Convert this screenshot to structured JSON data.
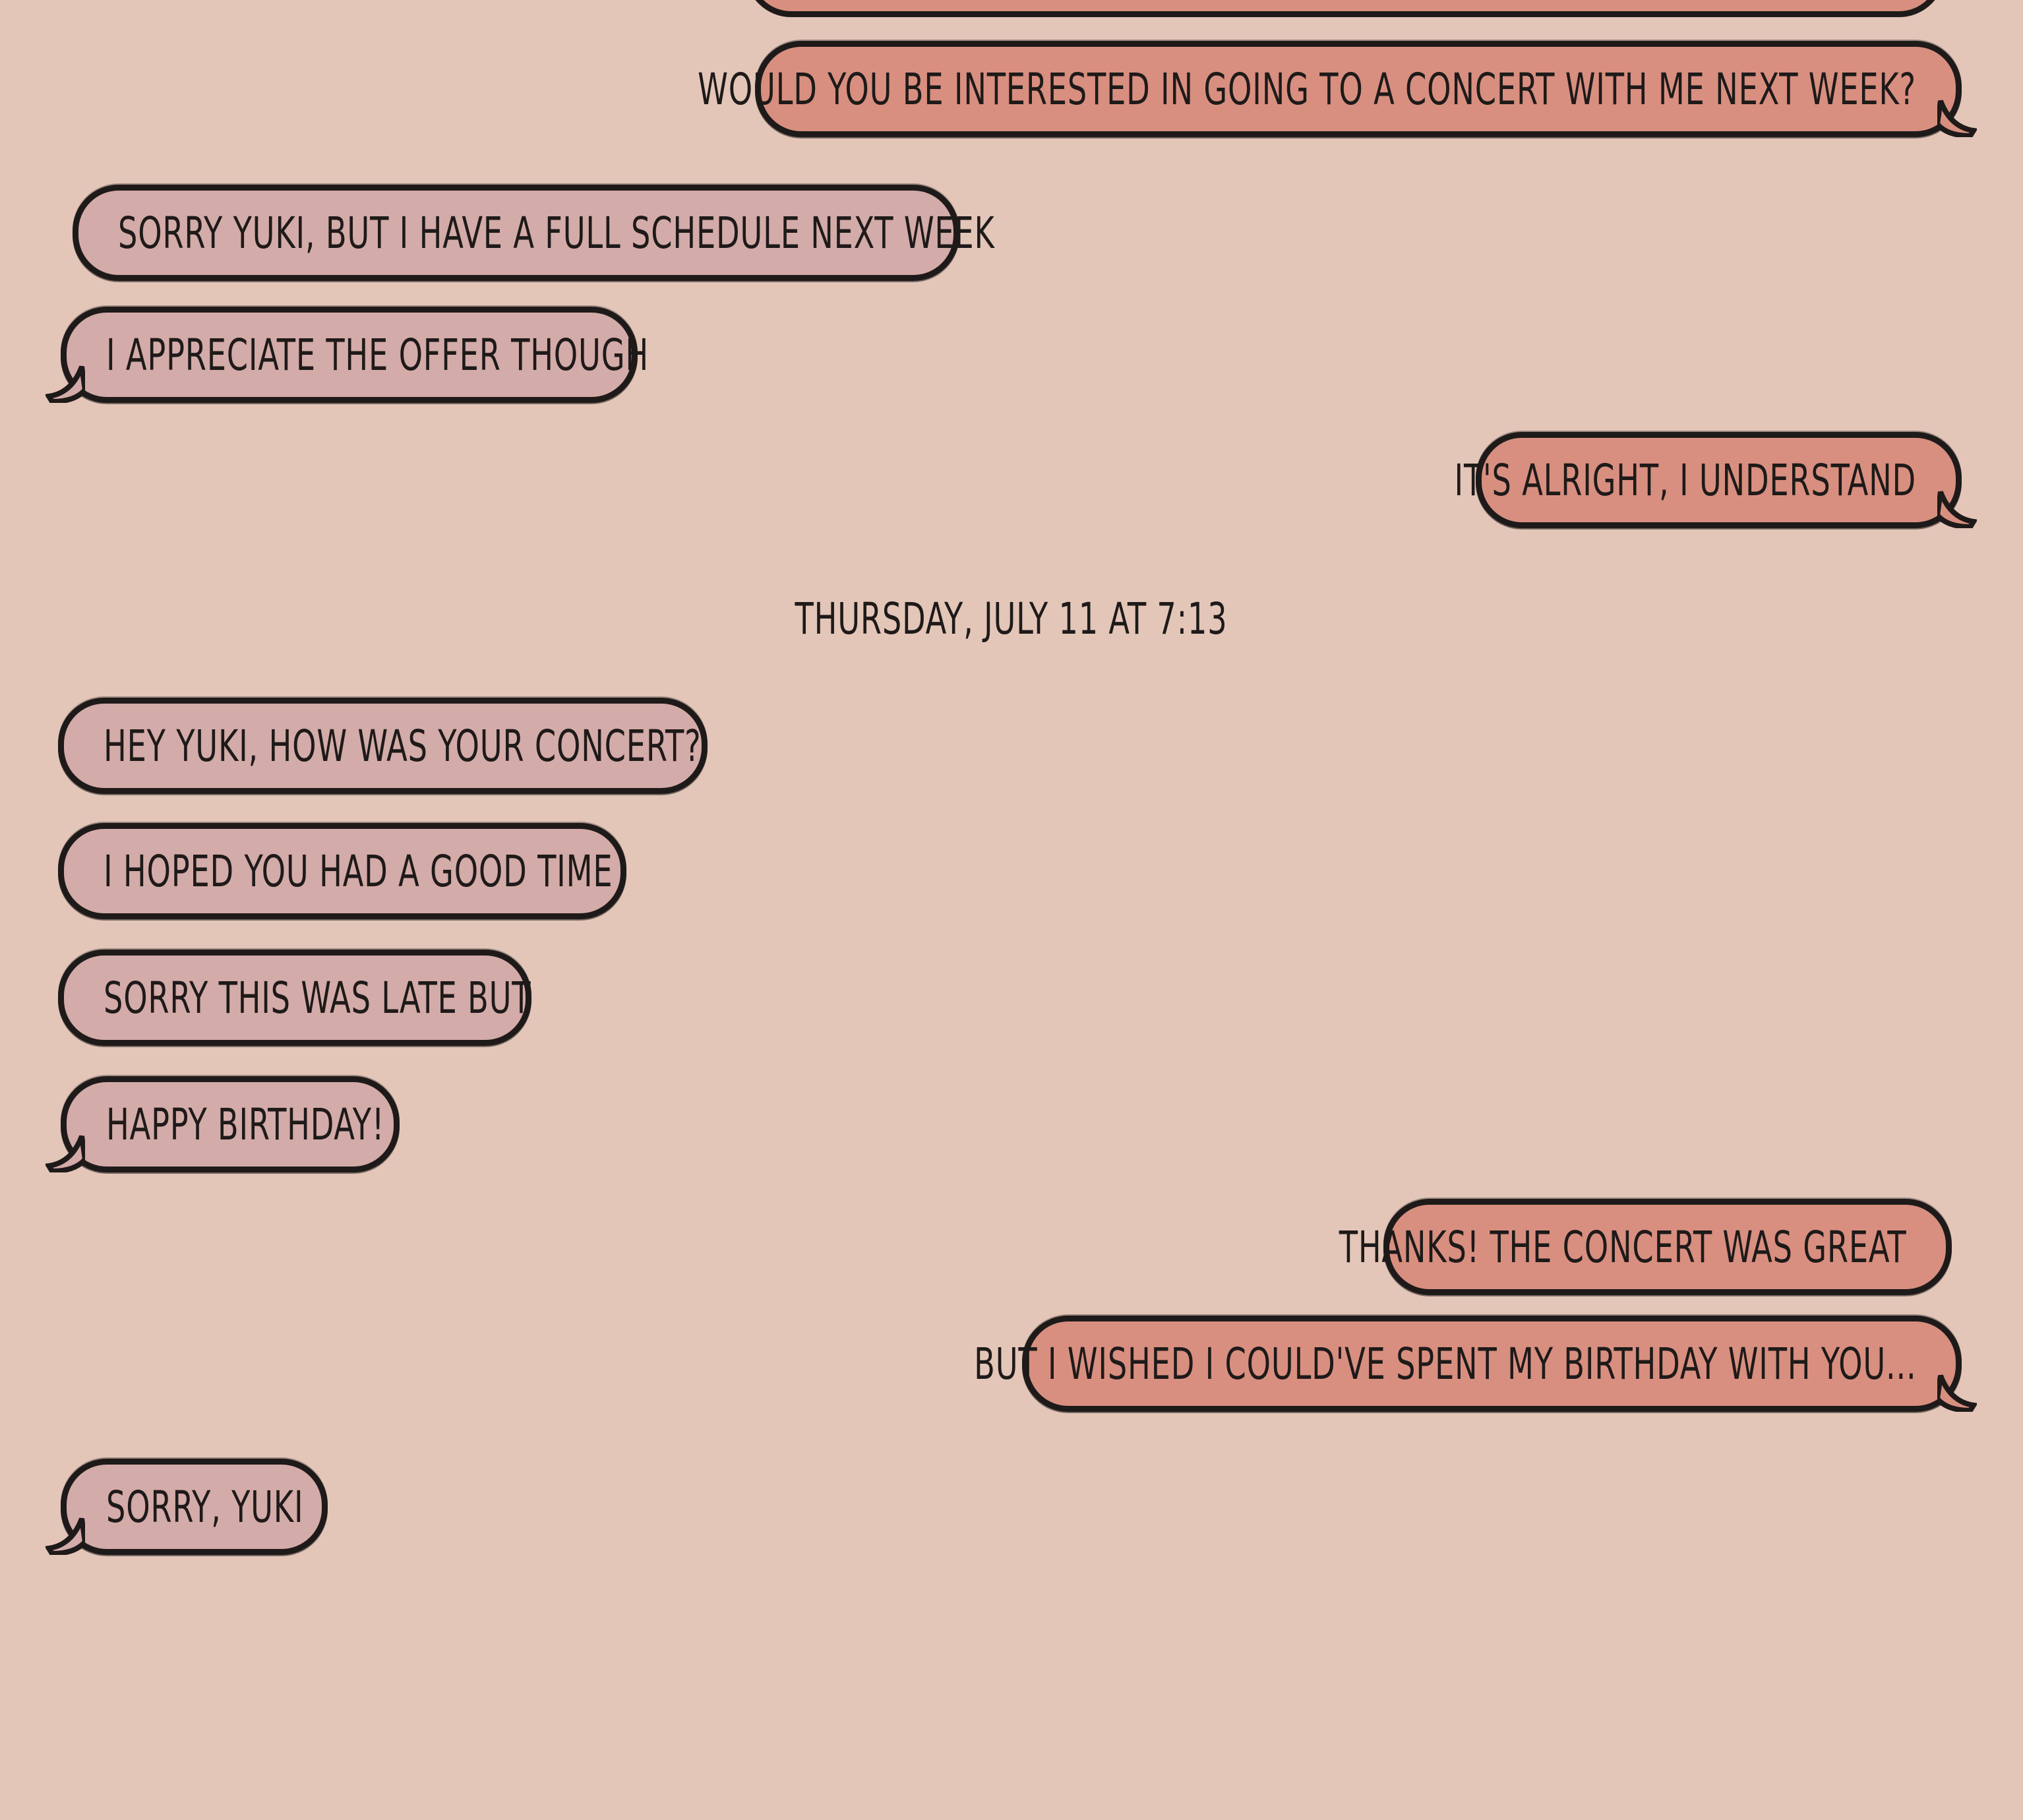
{
  "colors": {
    "background": "#e3c6b8",
    "received_bubble": "#d3aba8",
    "sent_bubble": "#d88f80",
    "outline": "#1e1a19"
  },
  "messages": {
    "m1": "Would you be interested in going to a concert with me next week?",
    "m2": "Sorry Yuki, but I have a full schedule next week",
    "m3": "I appreciate the offer though",
    "m4": "It's alright, I understand",
    "m5": "Hey Yuki, how was your concert?",
    "m6": "I hoped you had a good time",
    "m7": "Sorry this was late but",
    "m8": "Happy birthday!",
    "m9": "Thanks! The concert was great",
    "m10": "But I wished I could've spent my birthday with you...",
    "m11": "Sorry, Yuki"
  },
  "timestamp": "Thursday, July 11 at 7:13"
}
